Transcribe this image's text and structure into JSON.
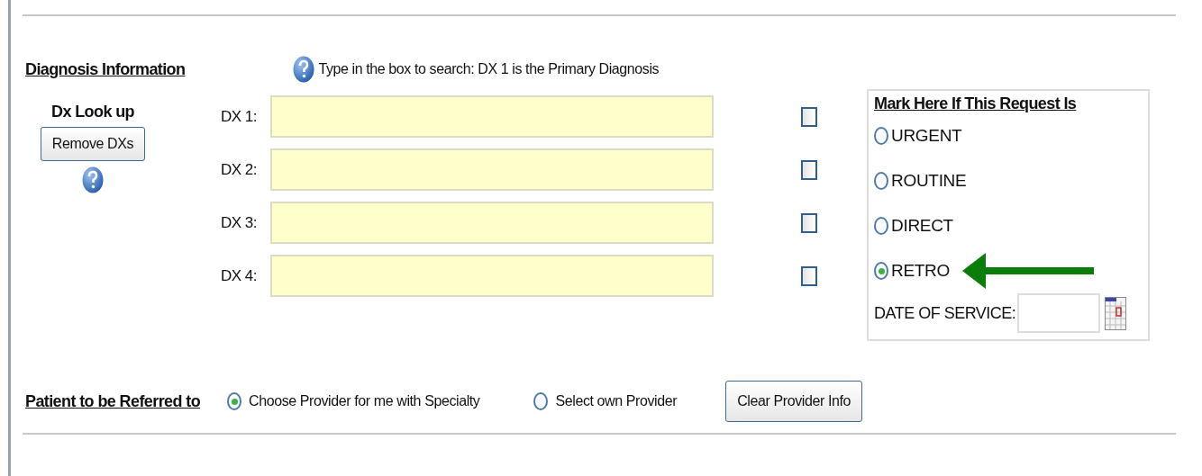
{
  "diagnosis": {
    "heading": "Diagnosis Information",
    "hint": "Type in the box to search: DX 1 is the Primary Diagnosis",
    "lookup_label": "Dx Look up",
    "remove_button": "Remove DXs",
    "dx_rows": [
      {
        "label": "DX 1:",
        "checked": false
      },
      {
        "label": "DX 2:",
        "checked": false
      },
      {
        "label": "DX 3:",
        "checked": false
      },
      {
        "label": "DX 4:",
        "checked": false
      }
    ]
  },
  "request_type": {
    "heading": "Mark Here If This Request Is",
    "options": [
      {
        "label": "URGENT",
        "selected": false
      },
      {
        "label": "ROUTINE",
        "selected": false
      },
      {
        "label": "DIRECT",
        "selected": false
      },
      {
        "label": "RETRO",
        "selected": true
      }
    ],
    "date_label": "DATE OF SERVICE:"
  },
  "referral": {
    "heading": "Patient to be Referred to",
    "options": [
      {
        "label": "Choose Provider for me with Specialty",
        "selected": true
      },
      {
        "label": "Select own Provider",
        "selected": false
      }
    ],
    "clear_button": "Clear Provider Info"
  }
}
